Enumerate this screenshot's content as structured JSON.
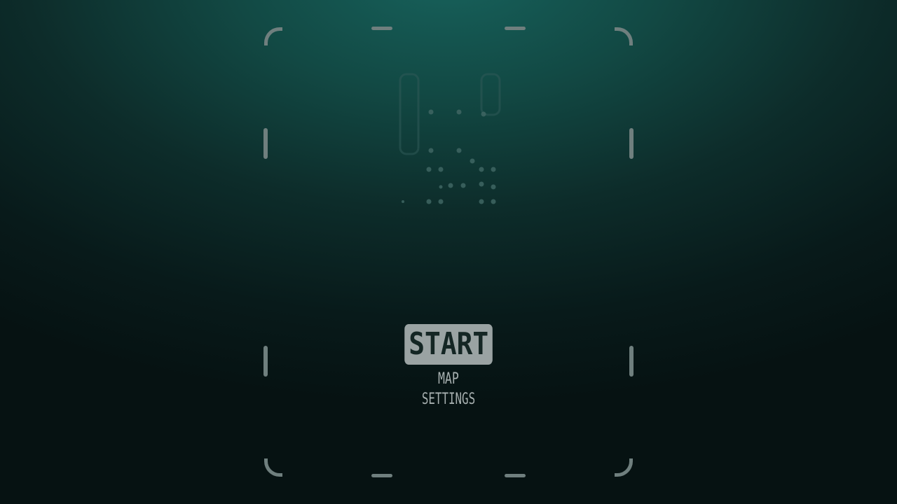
{
  "menu": {
    "start_label": "START",
    "map_label": "MAP",
    "settings_label": "SETTINGS",
    "selected": "START"
  },
  "colors": {
    "frame": "#6f7f7e",
    "selected_bg": "#9aa3a3",
    "selected_text": "#142624",
    "menu_text": "#a7b0b0",
    "bg_top": "#17625c",
    "bg_bottom": "#061212"
  },
  "logo": {
    "icon": "faded-game-logo-icon"
  }
}
